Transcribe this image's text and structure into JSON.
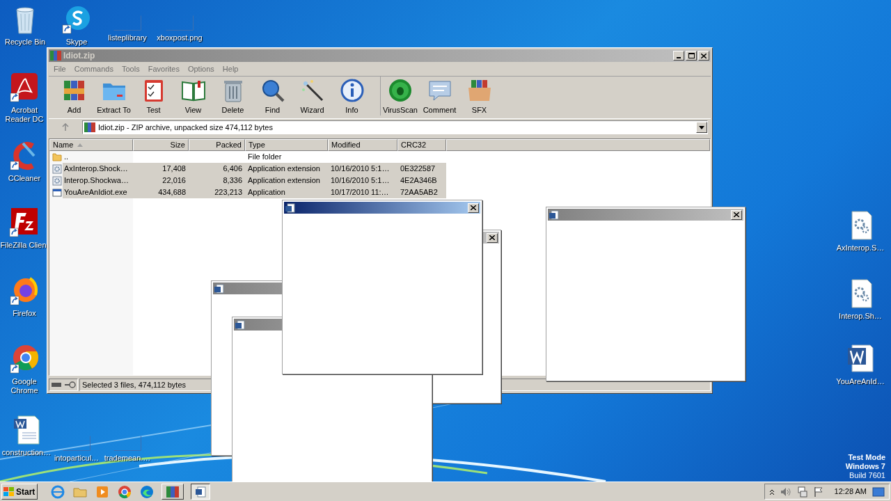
{
  "desktop_icons": [
    {
      "label": "Recycle Bin",
      "kind": "recycle"
    },
    {
      "label": "Skype",
      "kind": "skype"
    },
    {
      "label": "listeplibrary",
      "kind": "blank"
    },
    {
      "label": "xboxpost.png",
      "kind": "blank"
    },
    {
      "label": "Acrobat Reader DC",
      "kind": "acrobat"
    },
    {
      "label": "CCleaner",
      "kind": "ccleaner"
    },
    {
      "label": "FileZilla Clien",
      "kind": "filezilla"
    },
    {
      "label": "Firefox",
      "kind": "firefox"
    },
    {
      "label": "Google Chrome",
      "kind": "chrome"
    },
    {
      "label": "construction…",
      "kind": "worddoc"
    },
    {
      "label": "intoparticul…",
      "kind": "blank"
    },
    {
      "label": "trademean.…",
      "kind": "blank"
    },
    {
      "label": "AxInterop.S…",
      "kind": "dll"
    },
    {
      "label": "Interop.Sh…",
      "kind": "dll"
    },
    {
      "label": "YouAreAnId…",
      "kind": "word"
    }
  ],
  "archiver": {
    "title": "Idiot.zip",
    "menu": [
      "File",
      "Commands",
      "Tools",
      "Favorites",
      "Options",
      "Help"
    ],
    "toolbar": [
      {
        "label": "Add",
        "kind": "add"
      },
      {
        "label": "Extract To",
        "kind": "extract"
      },
      {
        "label": "Test",
        "kind": "test"
      },
      {
        "label": "View",
        "kind": "view"
      },
      {
        "label": "Delete",
        "kind": "delete"
      },
      {
        "label": "Find",
        "kind": "find"
      },
      {
        "label": "Wizard",
        "kind": "wizard"
      },
      {
        "label": "Info",
        "kind": "info"
      },
      {
        "label": "VirusScan",
        "kind": "virus"
      },
      {
        "label": "Comment",
        "kind": "comment"
      },
      {
        "label": "SFX",
        "kind": "sfx"
      }
    ],
    "path": "Idiot.zip - ZIP archive, unpacked size 474,112 bytes",
    "columns": [
      {
        "label": "Name",
        "sorted": true
      },
      {
        "label": "Size",
        "sorted": false
      },
      {
        "label": "Packed",
        "sorted": false
      },
      {
        "label": "Type",
        "sorted": false
      },
      {
        "label": "Modified",
        "sorted": false
      },
      {
        "label": "CRC32",
        "sorted": false
      }
    ],
    "rows": [
      {
        "kind": "folder",
        "selected": false,
        "cells": [
          "..",
          "",
          "",
          "File folder",
          "",
          ""
        ]
      },
      {
        "kind": "dll",
        "selected": true,
        "cells": [
          "AxInterop.Shock…",
          "17,408",
          "6,406",
          "Application extension",
          "10/16/2010 5:1…",
          "0E322587"
        ]
      },
      {
        "kind": "dll",
        "selected": true,
        "cells": [
          "Interop.Shockwa…",
          "22,016",
          "8,336",
          "Application extension",
          "10/16/2010 5:1…",
          "4E2A346B"
        ]
      },
      {
        "kind": "exe",
        "selected": true,
        "cells": [
          "YouAreAnIdiot.exe",
          "434,688",
          "223,213",
          "Application",
          "10/17/2010 11:…",
          "72AA5AB2"
        ]
      }
    ],
    "status": "Selected 3 files, 474,112 bytes"
  },
  "popups": [
    {
      "active": false
    },
    {
      "active": false
    },
    {
      "active": false
    },
    {
      "active": true
    },
    {
      "active": false
    }
  ],
  "os_notice": [
    "Test Mode",
    "Windows 7",
    "Build 7601"
  ],
  "taskbar": {
    "start": "Start",
    "clock": "12:28 AM"
  }
}
